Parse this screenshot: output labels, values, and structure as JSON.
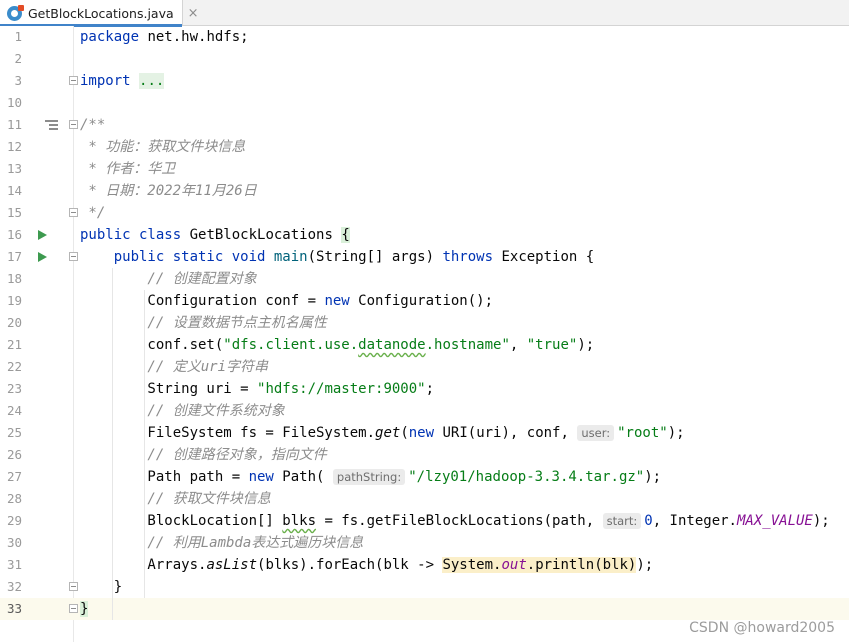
{
  "tab": {
    "title": "GetBlockLocations.java",
    "close_glyph": "×",
    "icon": "java-class-icon"
  },
  "lines": [
    {
      "n": "1",
      "text": "package net.hw.hdfs;"
    },
    {
      "n": "2",
      "text": ""
    },
    {
      "n": "3",
      "text": "import ..."
    },
    {
      "n": "10",
      "text": ""
    },
    {
      "n": "11",
      "text": "/**"
    },
    {
      "n": "12",
      "text": " * 功能：获取文件块信息"
    },
    {
      "n": "13",
      "text": " * 作者：华卫"
    },
    {
      "n": "14",
      "text": " * 日期：2022年11月26日"
    },
    {
      "n": "15",
      "text": " */"
    },
    {
      "n": "16",
      "text": "public class GetBlockLocations {"
    },
    {
      "n": "17",
      "text": "    public static void main(String[] args) throws Exception {"
    },
    {
      "n": "18",
      "text": "        // 创建配置对象"
    },
    {
      "n": "19",
      "text": "        Configuration conf = new Configuration();"
    },
    {
      "n": "20",
      "text": "        // 设置数据节点主机名属性"
    },
    {
      "n": "21",
      "text": "        conf.set(\"dfs.client.use.datanode.hostname\", \"true\");"
    },
    {
      "n": "22",
      "text": "        // 定义uri字符串"
    },
    {
      "n": "23",
      "text": "        String uri = \"hdfs://master:9000\";"
    },
    {
      "n": "24",
      "text": "        // 创建文件系统对象"
    },
    {
      "n": "25",
      "text": "        FileSystem fs = FileSystem.get(new URI(uri), conf, user: \"root\");"
    },
    {
      "n": "26",
      "text": "        // 创建路径对象，指向文件"
    },
    {
      "n": "27",
      "text": "        Path path = new Path( pathString: \"/lzy01/hadoop-3.3.4.tar.gz\");"
    },
    {
      "n": "28",
      "text": "        // 获取文件块信息"
    },
    {
      "n": "29",
      "text": "        BlockLocation[] blks = fs.getFileBlockLocations(path, start: 0, Integer.MAX_VALUE);"
    },
    {
      "n": "30",
      "text": "        // 利用Lambda表达式遍历块信息"
    },
    {
      "n": "31",
      "text": "        Arrays.asList(blks).forEach(blk -> System.out.println(blk));"
    },
    {
      "n": "32",
      "text": "    }"
    },
    {
      "n": "33",
      "text": "}"
    }
  ],
  "tokens": {
    "l1_kw": "package",
    "l1_rest": " net.hw.hdfs;",
    "l3_kw": "import",
    "l3_fold": "...",
    "l11": "/**",
    "l12": " * 功能：获取文件块信息",
    "l13": " * 作者：华卫",
    "l14a": " * 日期：",
    "l14b": "2022",
    "l14c": "年",
    "l14d": "11",
    "l14e": "月",
    "l14f": "26",
    "l14g": "日",
    "l15": " */",
    "l16_kw": "public class",
    "l16_name": " GetBlockLocations ",
    "l16_brace": "{",
    "l17_kw1": "    public static void",
    "l17_m": " main",
    "l17_a": "(String[] args) ",
    "l17_kw2": "throws",
    "l17_b": " Exception {",
    "l18": "        // 创建配置对象",
    "l19_a": "        Configuration conf = ",
    "l19_kw": "new",
    "l19_b": " Configuration();",
    "l20": "        // 设置数据节点主机名属性",
    "l21_a": "        conf.set(",
    "l21_s1a": "\"dfs.client.use.",
    "l21_s1b": "datanode",
    "l21_s1c": ".hostname\"",
    "l21_b": ", ",
    "l21_s2": "\"true\"",
    "l21_c": ");",
    "l22a": "        // 定义",
    "l22b": "uri",
    "l22c": "字符串",
    "l23_a": "        String uri = ",
    "l23_s": "\"hdfs://master:9000\"",
    "l23_b": ";",
    "l24": "        // 创建文件系统对象",
    "l25_a": "        FileSystem fs = FileSystem.",
    "l25_m": "get",
    "l25_b": "(",
    "l25_kw": "new",
    "l25_c": " URI(uri), conf, ",
    "l25_hint": "user:",
    "l25_s": "\"root\"",
    "l25_d": ");",
    "l26": "        // 创建路径对象，指向文件",
    "l27_a": "        Path path = ",
    "l27_kw": "new",
    "l27_b": " Path( ",
    "l27_hint": "pathString:",
    "l27_s": "\"/lzy01/hadoop-3.3.4.tar.gz\"",
    "l27_c": ");",
    "l28": "        // 获取文件块信息",
    "l29_a": "        BlockLocation[] ",
    "l29_v": "blks",
    "l29_b": " = fs.getFileBlockLocations(path, ",
    "l29_hint": "start:",
    "l29_n": "0",
    "l29_c": ", Integer.",
    "l29_st": "MAX_VALUE",
    "l29_d": ");",
    "l30a": "        // 利用",
    "l30b": "Lambda",
    "l30c": "表达式遍历块信息",
    "l31_a": "        Arrays.",
    "l31_m": "asList",
    "l31_b": "(blks).forEach(blk -> ",
    "l31_c1": "System.",
    "l31_c2": "out",
    "l31_c3": ".println(blk)",
    "l31_d": ");",
    "l32": "    }",
    "l33": "}"
  },
  "watermark": "CSDN @howard2005",
  "colors": {
    "keyword": "#0033b3",
    "string": "#067d17",
    "comment": "#8c8c8c",
    "static_field": "#871094",
    "run_icon": "#3d9a4f",
    "tab_accent": "#4083c9"
  }
}
